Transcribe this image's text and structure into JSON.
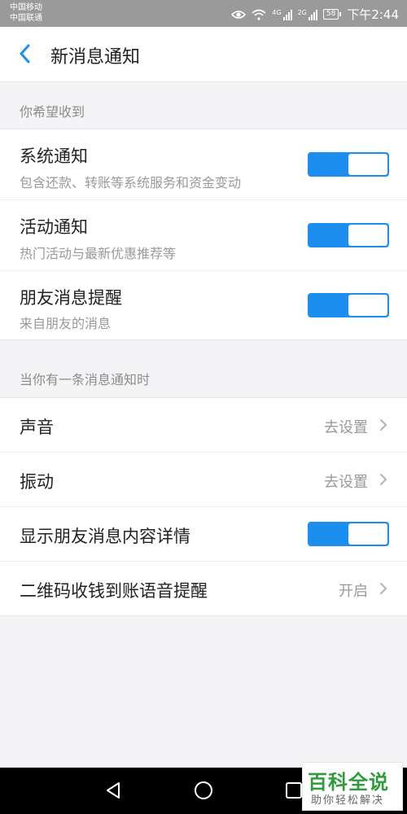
{
  "status_bar": {
    "carrier_1": "中国移动",
    "carrier_2": "中国联通",
    "signal_1_label": "4G",
    "signal_2_label": "2G",
    "battery": "58",
    "time": "下午2:44"
  },
  "header": {
    "title": "新消息通知"
  },
  "section_1": {
    "label": "你希望收到",
    "rows": [
      {
        "title": "系统通知",
        "subtitle": "包含还款、转账等系统服务和资金变动",
        "enabled": true
      },
      {
        "title": "活动通知",
        "subtitle": "热门活动与最新优惠推荐等",
        "enabled": true
      },
      {
        "title": "朋友消息提醒",
        "subtitle": "来自朋友的消息",
        "enabled": true
      }
    ]
  },
  "section_2": {
    "label": "当你有一条消息通知时",
    "rows": [
      {
        "title": "声音",
        "value": "去设置"
      },
      {
        "title": "振动",
        "value": "去设置"
      },
      {
        "title": "显示朋友消息内容详情",
        "enabled": true
      },
      {
        "title": "二维码收钱到账语音提醒",
        "value": "开启"
      }
    ]
  },
  "watermark": {
    "main": "百科全说",
    "sub": "助你轻松解决"
  },
  "colors": {
    "accent": "#1b8ef0",
    "status_bar_bg": "#9a9a9a",
    "page_bg": "#f4f4f6"
  }
}
